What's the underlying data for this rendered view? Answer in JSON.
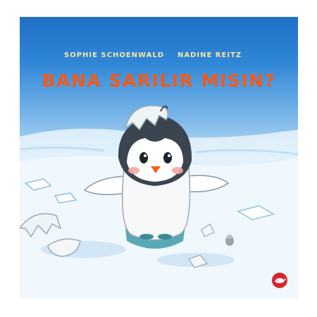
{
  "cover": {
    "author": "SOPHIE SCHOENWALD",
    "illustrator": "NADINE REITZ",
    "title": "BANA SARILIR MISIN?"
  },
  "colors": {
    "sky_top": "#1f6fc4",
    "snow": "#eef6fd",
    "title": "#f05a1c",
    "names": "#f6e6a6",
    "penguin_dark": "#3a4550",
    "beak": "#f2621e",
    "cheeks": "#f6a6a0",
    "logo": "#d6262c"
  },
  "icons": {
    "publisher_logo": "whale-logo-icon"
  }
}
